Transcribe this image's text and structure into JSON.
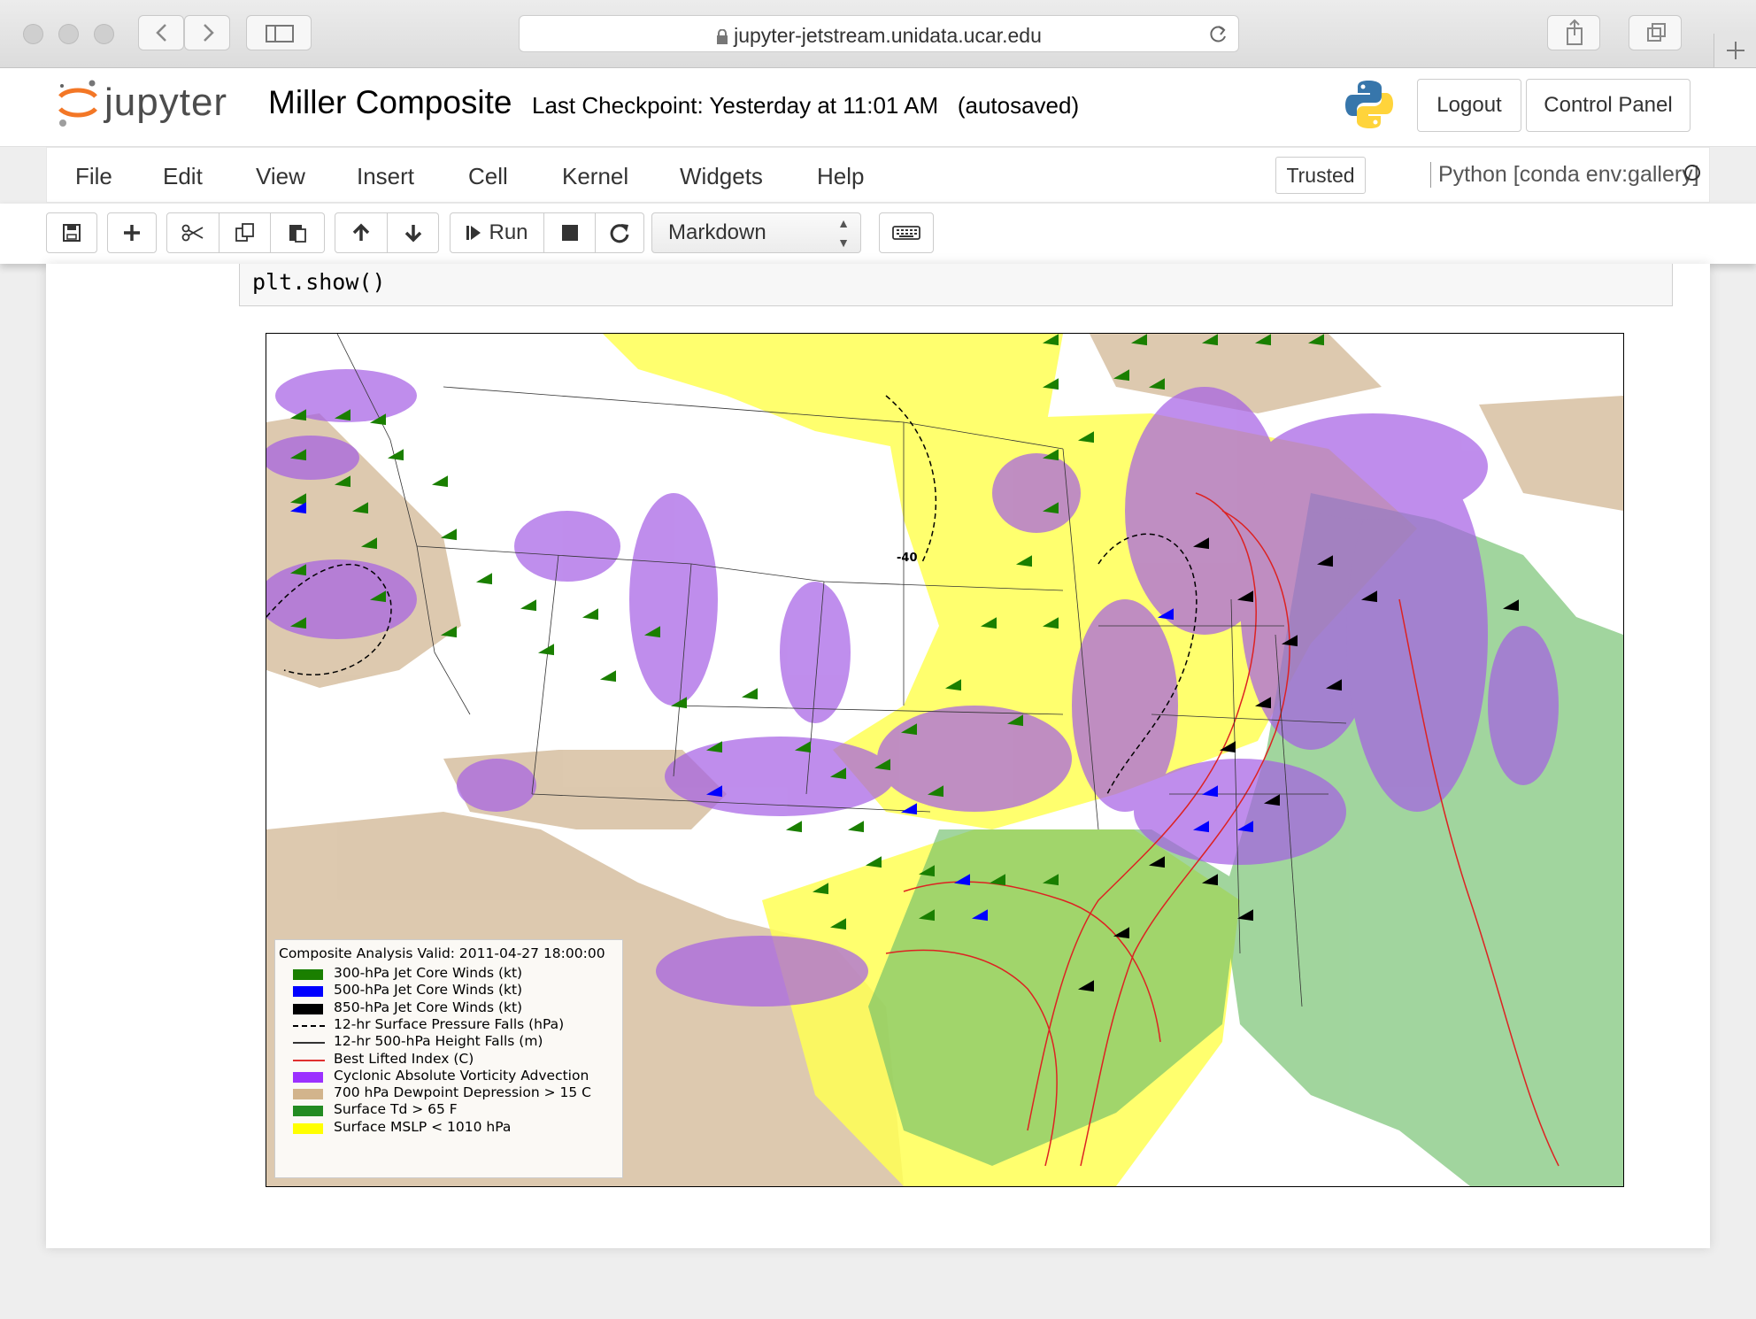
{
  "browser": {
    "url": "jupyter-jetstream.unidata.ucar.edu"
  },
  "header": {
    "logo_text": "jupyter",
    "notebook_name": "Miller Composite",
    "checkpoint": "Last Checkpoint: Yesterday at 11:01 AM",
    "autosave": "(autosaved)",
    "logout_label": "Logout",
    "control_panel_label": "Control Panel"
  },
  "menubar": {
    "items": [
      "File",
      "Edit",
      "View",
      "Insert",
      "Cell",
      "Kernel",
      "Widgets",
      "Help"
    ],
    "trusted_label": "Trusted",
    "kernel_name": "Python [conda env:gallery]"
  },
  "toolbar": {
    "run_label": "Run",
    "cell_type": "Markdown"
  },
  "cell": {
    "code": "plt.show()"
  },
  "legend": {
    "title": "Composite Analysis Valid: 2011-04-27 18:00:00",
    "items": [
      {
        "label": "300-hPa Jet Core Winds (kt)",
        "kind": "swatch",
        "color": "#1a7f00"
      },
      {
        "label": "500-hPa Jet Core Winds (kt)",
        "kind": "swatch",
        "color": "#0000ff"
      },
      {
        "label": "850-hPa Jet Core Winds (kt)",
        "kind": "swatch",
        "color": "#000000"
      },
      {
        "label": "12-hr Surface Pressure Falls (hPa)",
        "kind": "dashed",
        "color": "#000000"
      },
      {
        "label": "12-hr 500-hPa Height Falls (m)",
        "kind": "solid",
        "color": "#333333"
      },
      {
        "label": "Best Lifted Index (C)",
        "kind": "solid",
        "color": "#e03030"
      },
      {
        "label": "Cyclonic Absolute Vorticity Advection",
        "kind": "swatch",
        "color": "#9b30ff"
      },
      {
        "label": "700 hPa Dewpoint Depression > 15 C",
        "kind": "swatch",
        "color": "#d2b48c"
      },
      {
        "label": "Surface Td > 65 F",
        "kind": "swatch",
        "color": "#228b22"
      },
      {
        "label": "Surface MSLP < 1010 hPa",
        "kind": "swatch",
        "color": "#ffff00"
      }
    ]
  },
  "map": {
    "contour_label": "-40"
  }
}
